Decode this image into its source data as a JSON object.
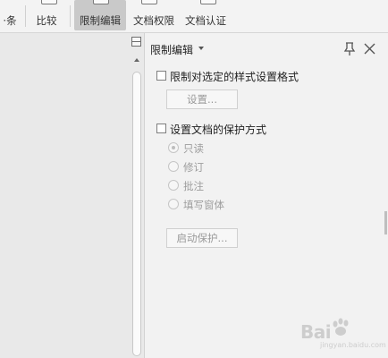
{
  "toolbar": {
    "items": [
      {
        "label": "·条"
      },
      {
        "label": "比较"
      },
      {
        "label": "限制编辑"
      },
      {
        "label": "文档权限"
      },
      {
        "label": "文档认证"
      }
    ]
  },
  "pane": {
    "title": "限制编辑",
    "section1": {
      "checkbox_label": "限制对选定的样式设置格式",
      "button_label": "设置..."
    },
    "section2": {
      "checkbox_label": "设置文档的保护方式",
      "options": [
        {
          "label": "只读",
          "selected": true
        },
        {
          "label": "修订",
          "selected": false
        },
        {
          "label": "批注",
          "selected": false
        },
        {
          "label": "填写窗体",
          "selected": false
        }
      ],
      "start_button_label": "启动保护..."
    }
  },
  "watermark": {
    "text": "Bai",
    "sub": "jingyan.baidu.com"
  }
}
